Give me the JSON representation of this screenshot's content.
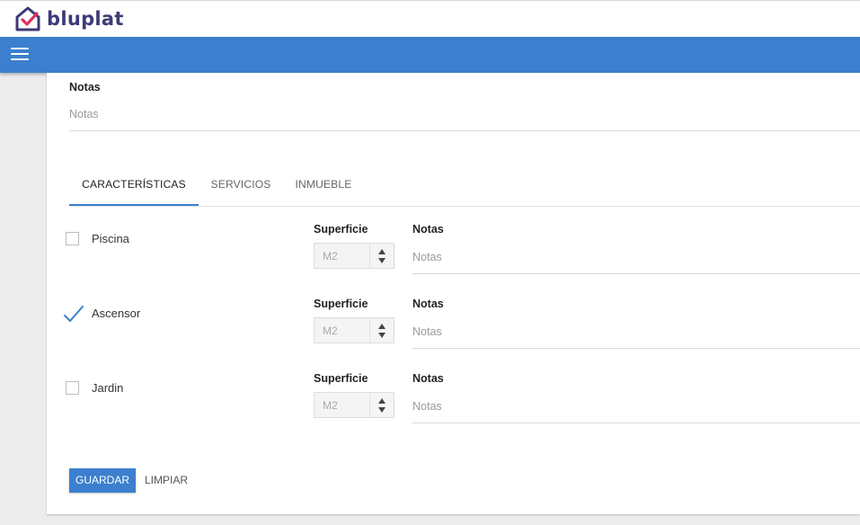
{
  "brand": {
    "name": "bluplat",
    "color": "#3d3a78",
    "accent": "#e0315a"
  },
  "navbar": {
    "menu_icon": "hamburger-menu-icon",
    "color": "#3b7fce"
  },
  "form": {
    "notes_label": "Notas",
    "notes_placeholder": "Notas",
    "tabs": [
      {
        "label": "CARACTERÍSTICAS",
        "active": true
      },
      {
        "label": "SERVICIOS",
        "active": false
      },
      {
        "label": "INMUEBLE",
        "active": false
      }
    ],
    "features": [
      {
        "label": "Piscina",
        "checked": false,
        "surface_label": "Superficie",
        "surface_placeholder": "M2",
        "notes_label": "Notas",
        "notes_placeholder": "Notas"
      },
      {
        "label": "Ascensor",
        "checked": true,
        "surface_label": "Superficie",
        "surface_placeholder": "M2",
        "notes_label": "Notas",
        "notes_placeholder": "Notas"
      },
      {
        "label": "Jardin",
        "checked": false,
        "surface_label": "Superficie",
        "surface_placeholder": "M2",
        "notes_label": "Notas",
        "notes_placeholder": "Notas"
      }
    ],
    "save_label": "GUARDAR",
    "clear_label": "LIMPIAR"
  }
}
